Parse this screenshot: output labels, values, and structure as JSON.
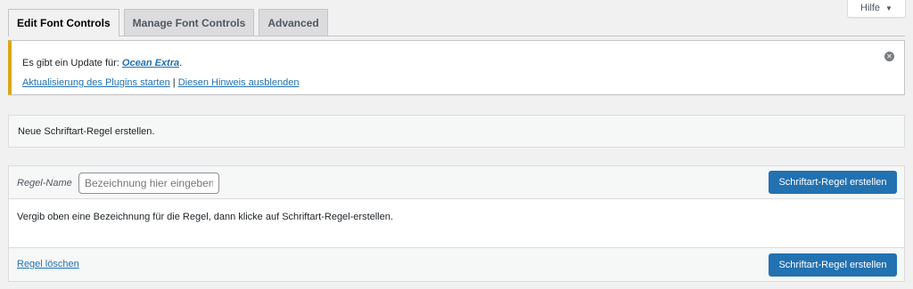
{
  "help": {
    "label": "Hilfe",
    "caret": "▼"
  },
  "tabs": [
    {
      "label": "Edit Font Controls",
      "active": true
    },
    {
      "label": "Manage Font Controls",
      "active": false
    },
    {
      "label": "Advanced",
      "active": false
    }
  ],
  "notice": {
    "prefix": "Es gibt ein Update für: ",
    "plugin_name": "Ocean Extra",
    "suffix": ".",
    "update_link": "Aktualisierung des Plugins starten",
    "separator": " | ",
    "hide_link": "Diesen Hinweis ausblenden",
    "dismiss_glyph": "✕",
    "accent_color": "#dba617"
  },
  "info": {
    "text": "Neue Schriftart-Regel erstellen."
  },
  "rule_panel": {
    "name_label": "Regel-Name",
    "name_placeholder": "Bezeichnung hier eingeben",
    "create_button": "Schriftart-Regel erstellen",
    "description": "Vergib oben eine Bezeichnung für die Regel, dann klicke auf Schriftart-Regel-erstellen.",
    "delete_link": "Regel löschen",
    "footer_create_button": "Schriftart-Regel erstellen",
    "button_color": "#2271b1"
  }
}
